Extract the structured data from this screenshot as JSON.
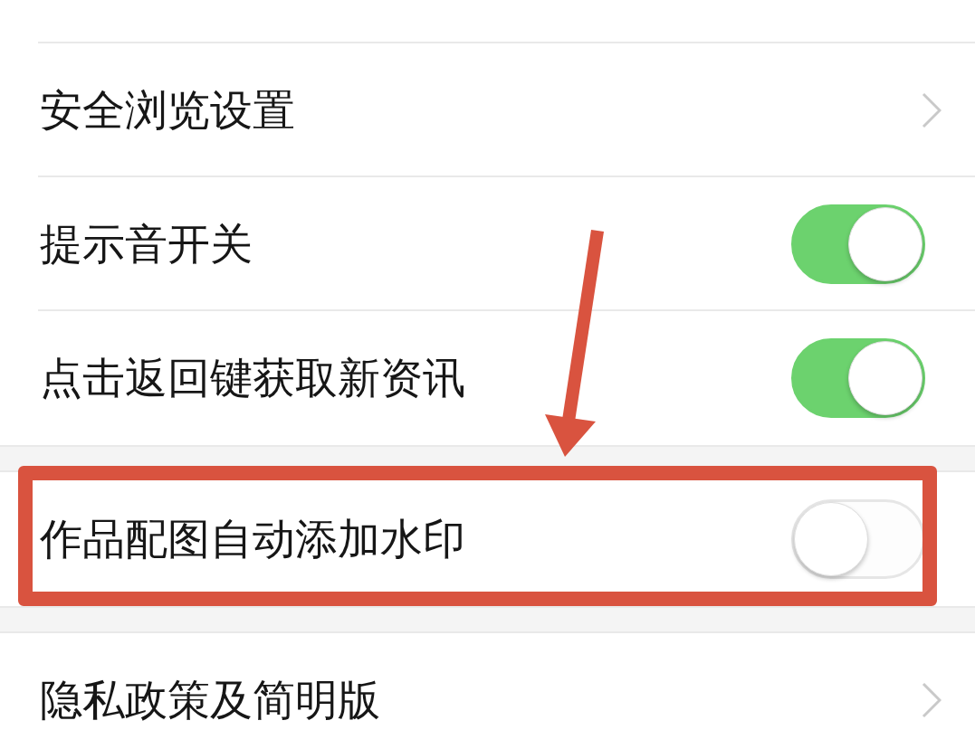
{
  "settings_groups": [
    {
      "items": [
        {
          "label": "安全浏览设置",
          "kind": "link",
          "highlighted": false
        },
        {
          "label": "提示音开关",
          "kind": "toggle",
          "on": true,
          "highlighted": false
        },
        {
          "label": "点击返回键获取新资讯",
          "kind": "toggle",
          "on": true,
          "highlighted": false
        }
      ]
    },
    {
      "items": [
        {
          "label": "作品配图自动添加水印",
          "kind": "toggle",
          "on": false,
          "highlighted": true
        }
      ]
    },
    {
      "items": [
        {
          "label": "隐私政策及简明版",
          "kind": "link",
          "highlighted": false
        }
      ]
    }
  ]
}
